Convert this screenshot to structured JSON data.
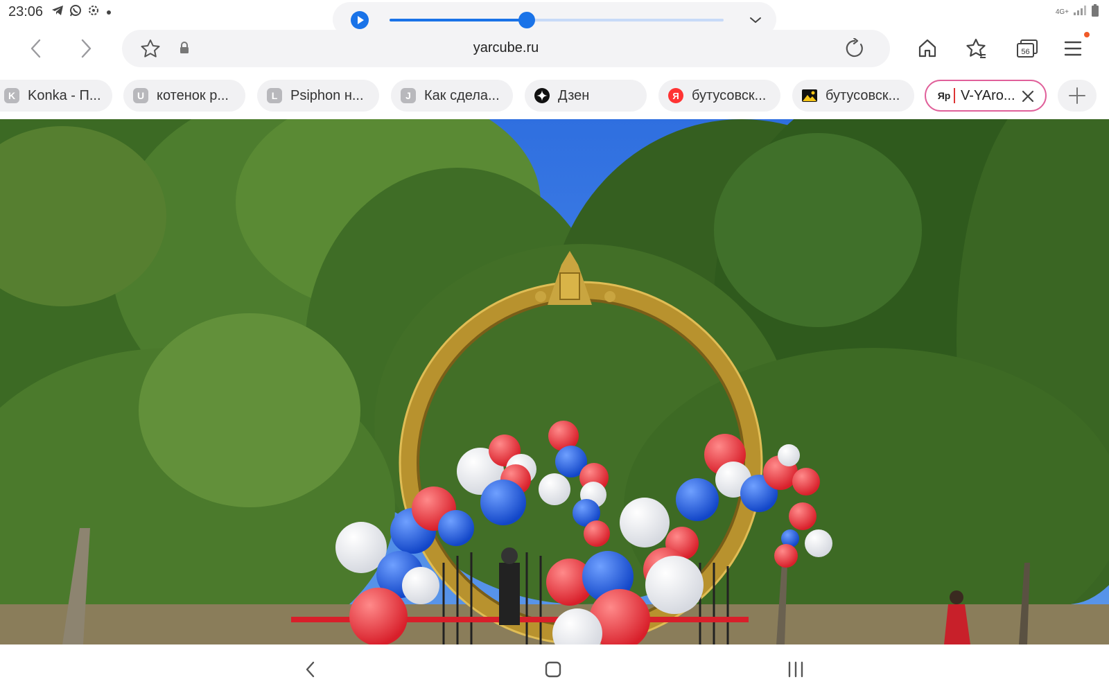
{
  "status_bar": {
    "time": "23:06",
    "network_label": "4G+",
    "icons": [
      "telegram-icon",
      "whatsapp-icon",
      "vk-icon",
      "dot-icon",
      "signal-icon",
      "battery-icon"
    ]
  },
  "media_player": {
    "progress": 0.41,
    "accent_color": "#1a73e8"
  },
  "toolbar": {
    "url": "yarcube.ru",
    "tabs_count": "56"
  },
  "tabs": [
    {
      "icon_letter": "K",
      "label": "Konka - П..."
    },
    {
      "icon_letter": "U",
      "label": "котенок р..."
    },
    {
      "icon_letter": "L",
      "label": "Psiphon н..."
    },
    {
      "icon_letter": "J",
      "label": "Как сдела..."
    },
    {
      "icon_letter": "",
      "icon": "dzen-icon",
      "label": "Дзен"
    },
    {
      "icon_letter": "Я",
      "icon": "yandex-icon",
      "label": "бутусовск..."
    },
    {
      "icon_letter": "",
      "icon": "image-icon",
      "label": "бутусовск..."
    },
    {
      "icon_letter": "Яр",
      "icon": "yarcube-icon",
      "label": "V-YAro...",
      "active": true
    }
  ],
  "colors": {
    "active_tab_border": "#e0609a",
    "notification_dot": "#f05a28"
  }
}
